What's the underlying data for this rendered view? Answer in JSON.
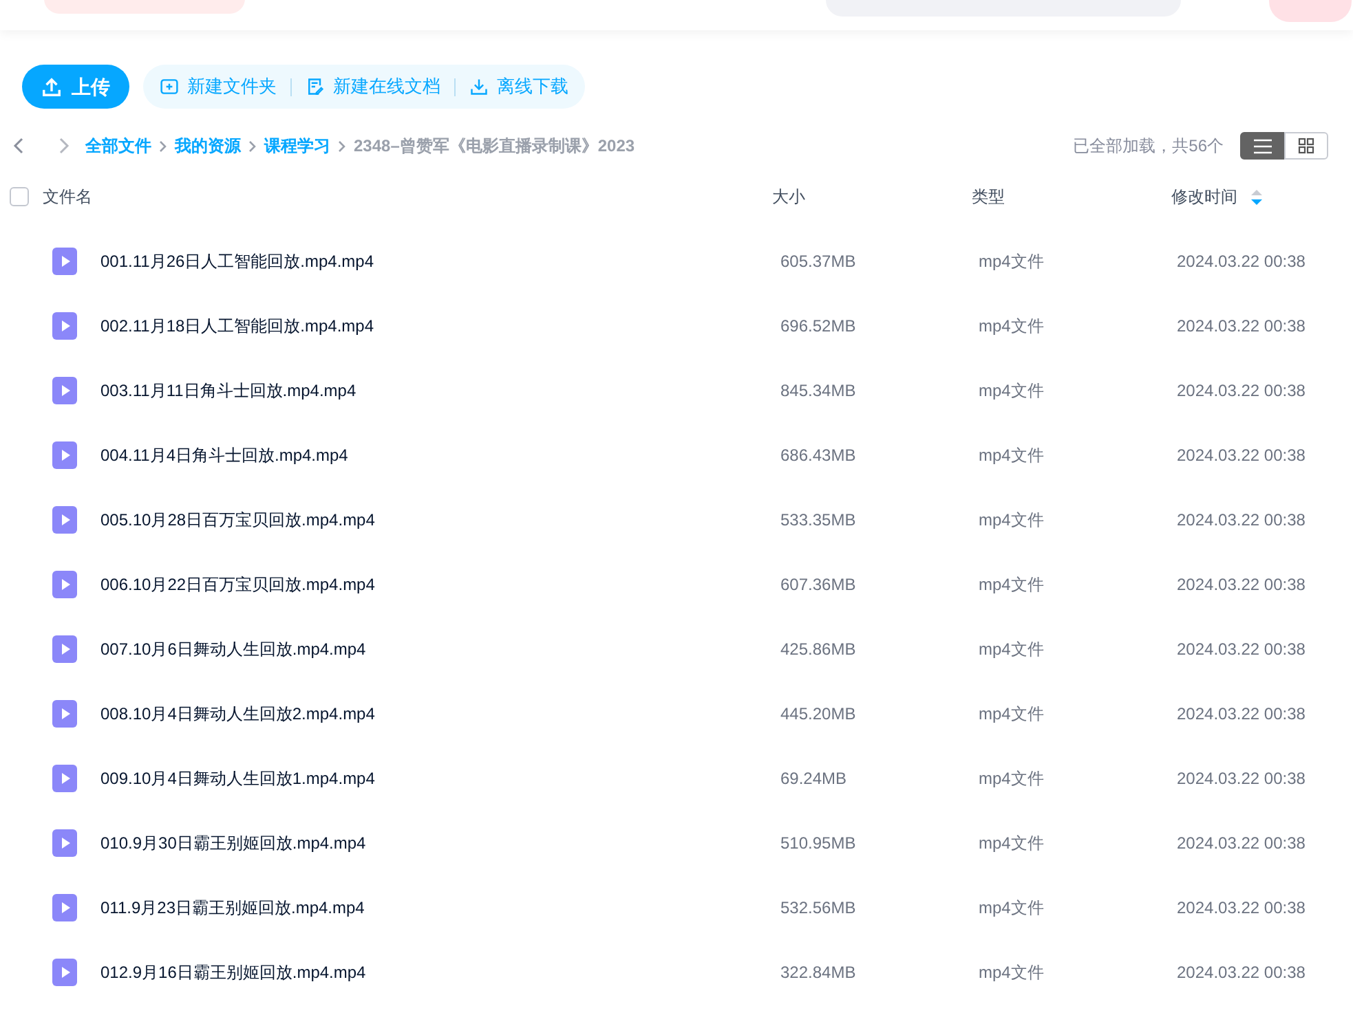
{
  "toolbar": {
    "upload": "上传",
    "actions": [
      {
        "kind": "folder",
        "label": "新建文件夹"
      },
      {
        "kind": "doc",
        "label": "新建在线文档"
      },
      {
        "kind": "download",
        "label": "离线下载"
      }
    ]
  },
  "breadcrumb": {
    "items": [
      "全部文件",
      "我的资源",
      "课程学习"
    ],
    "current": "2348–曾赞军《电影直播录制课》2023",
    "status": "已全部加载，共56个",
    "views": [
      {
        "kind": "list",
        "selected": true
      },
      {
        "kind": "grid",
        "selected": false
      }
    ]
  },
  "table": {
    "select_all": {
      "checked": false
    },
    "columns": [
      "文件名",
      "大小",
      "类型",
      "修改时间"
    ],
    "rows": [
      {
        "name": "001.11月26日人工智能回放.mp4.mp4",
        "size": "605.37MB",
        "type": "mp4文件",
        "modified": "2024.03.22 00:38"
      },
      {
        "name": "002.11月18日人工智能回放.mp4.mp4",
        "size": "696.52MB",
        "type": "mp4文件",
        "modified": "2024.03.22 00:38"
      },
      {
        "name": "003.11月11日角斗士回放.mp4.mp4",
        "size": "845.34MB",
        "type": "mp4文件",
        "modified": "2024.03.22 00:38"
      },
      {
        "name": "004.11月4日角斗士回放.mp4.mp4",
        "size": "686.43MB",
        "type": "mp4文件",
        "modified": "2024.03.22 00:38"
      },
      {
        "name": "005.10月28日百万宝贝回放.mp4.mp4",
        "size": "533.35MB",
        "type": "mp4文件",
        "modified": "2024.03.22 00:38"
      },
      {
        "name": "006.10月22日百万宝贝回放.mp4.mp4",
        "size": "607.36MB",
        "type": "mp4文件",
        "modified": "2024.03.22 00:38"
      },
      {
        "name": "007.10月6日舞动人生回放.mp4.mp4",
        "size": "425.86MB",
        "type": "mp4文件",
        "modified": "2024.03.22 00:38"
      },
      {
        "name": "008.10月4日舞动人生回放2.mp4.mp4",
        "size": "445.20MB",
        "type": "mp4文件",
        "modified": "2024.03.22 00:38"
      },
      {
        "name": "009.10月4日舞动人生回放1.mp4.mp4",
        "size": "69.24MB",
        "type": "mp4文件",
        "modified": "2024.03.22 00:38"
      },
      {
        "name": "010.9月30日霸王别姬回放.mp4.mp4",
        "size": "510.95MB",
        "type": "mp4文件",
        "modified": "2024.03.22 00:38"
      },
      {
        "name": "011.9月23日霸王别姬回放.mp4.mp4",
        "size": "532.56MB",
        "type": "mp4文件",
        "modified": "2024.03.22 00:38"
      },
      {
        "name": "012.9月16日霸王别姬回放.mp4.mp4",
        "size": "322.84MB",
        "type": "mp4文件",
        "modified": "2024.03.22 00:38"
      }
    ]
  }
}
